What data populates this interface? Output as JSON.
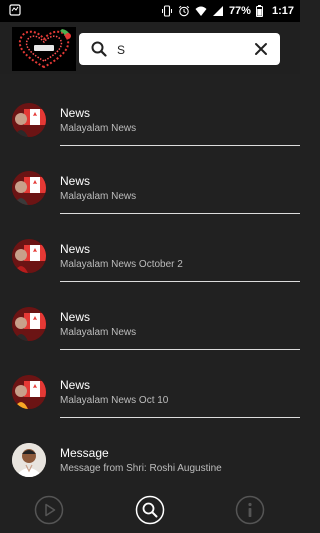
{
  "status_bar": {
    "battery": "77%",
    "time": "1:17"
  },
  "header": {
    "search": {
      "value": "S",
      "placeholder": ""
    }
  },
  "items": [
    {
      "title": "News",
      "subtitle": "Malayalam News",
      "icon": "news-thumbnail"
    },
    {
      "title": "News",
      "subtitle": "Malayalam News",
      "icon": "news-thumbnail"
    },
    {
      "title": "News",
      "subtitle": "Malayalam News October 2",
      "icon": "news-thumbnail"
    },
    {
      "title": "News",
      "subtitle": "Malayalam News",
      "icon": "news-thumbnail"
    },
    {
      "title": "News",
      "subtitle": "Malayalam News Oct 10",
      "icon": "news-thumbnail"
    },
    {
      "title": "Message",
      "subtitle": "Message from Shri: Roshi Augustine",
      "icon": "person-avatar"
    }
  ],
  "bottom_nav": {
    "buttons": [
      "play-icon",
      "search-icon",
      "info-icon"
    ],
    "active": "search-icon"
  },
  "colors": {
    "background": "#212121",
    "status_bar": "#000000",
    "text": "#ffffff",
    "subtext": "#bdbdbd",
    "accent_red": "#d32f2f",
    "divider": "#dcdcdc",
    "nav_inactive": "#555555"
  }
}
